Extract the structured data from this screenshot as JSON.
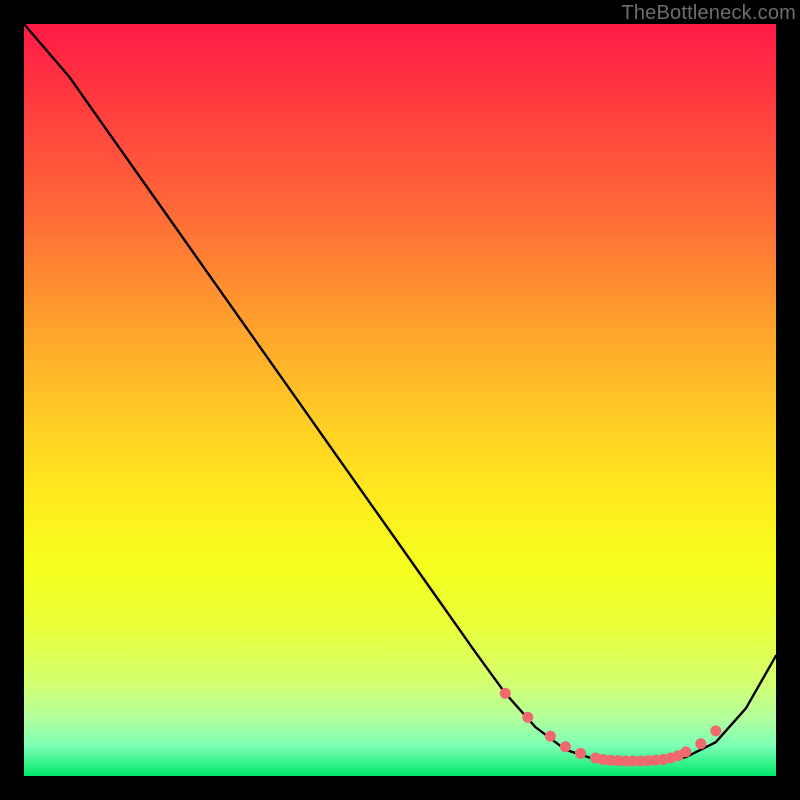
{
  "watermark": "TheBottleneck.com",
  "chart_data": {
    "type": "line",
    "title": "",
    "xlabel": "",
    "ylabel": "",
    "xlim": [
      0,
      100
    ],
    "ylim": [
      0,
      100
    ],
    "series": [
      {
        "name": "curve",
        "x": [
          0,
          6,
          12,
          18,
          24,
          30,
          36,
          42,
          48,
          54,
          60,
          64,
          68,
          72,
          76,
          80,
          84,
          88,
          92,
          96,
          100
        ],
        "y": [
          100,
          93,
          84.5,
          76,
          67.5,
          59,
          50.5,
          42,
          33.5,
          25,
          16.5,
          11,
          6.5,
          3.5,
          2.2,
          2,
          2,
          2.5,
          4.5,
          9,
          16
        ]
      }
    ],
    "markers": {
      "name": "dots",
      "x": [
        64,
        67,
        70,
        72,
        74,
        76,
        77,
        78,
        79,
        80,
        81,
        82,
        83,
        84,
        85,
        86,
        87,
        88,
        90,
        92
      ],
      "y": [
        11,
        7.8,
        5.3,
        3.9,
        3.0,
        2.4,
        2.2,
        2.1,
        2.05,
        2.0,
        2.0,
        2.0,
        2.05,
        2.1,
        2.2,
        2.4,
        2.7,
        3.2,
        4.3,
        6.0
      ]
    },
    "colors": {
      "curve": "#000000",
      "markers": "#ef6a6f"
    }
  }
}
